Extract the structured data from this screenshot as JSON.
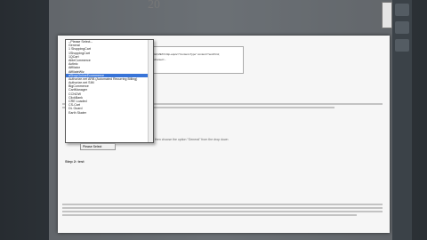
{
  "calendar": {
    "top_number": "20",
    "side_number": "14"
  },
  "code_lines": [
    "&lt;META http-equiv=\"Content-Type\" content=\"text/html;",
    "charset=..."
  ],
  "instruction_text": "then choose the option \"General\" from the drop down",
  "step_heading": "Step 2: test",
  "dropdown": {
    "options": [
      "--Please Select--",
      "General",
      "1 ShoppingCart",
      "1ShoppingCart",
      "1QCart",
      "AbleCommerce",
      "Actinic",
      "Affiliator",
      "AffiliateWiz",
      "aShopOnlineEcommerce",
      "Authorize.net ARB (Automated Recurring Billing)",
      "Authorize.net SIM",
      "BigCommerce",
      "CartManager",
      "CCNOW",
      "ClickBank",
      "CRE Loaded",
      "CS-Cart",
      "DL Guard",
      "Earth Skater"
    ],
    "selected_index": 9
  },
  "select_value": "Please Select"
}
